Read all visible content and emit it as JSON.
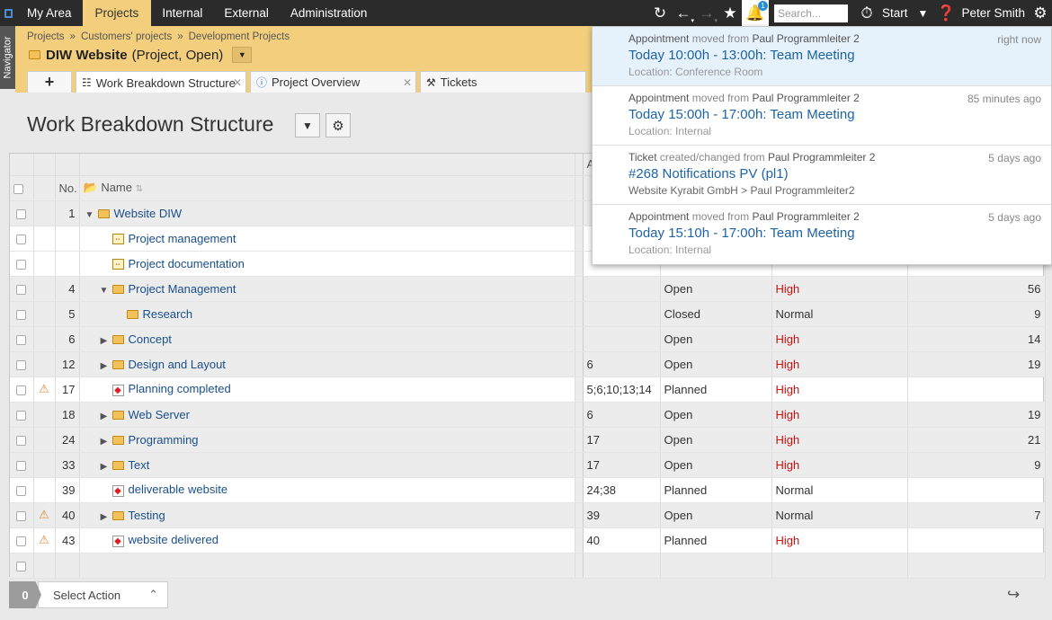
{
  "topnav": {
    "items": [
      "My Area",
      "Projects",
      "Internal",
      "External",
      "Administration"
    ],
    "active_index": 1
  },
  "toolbar": {
    "search_placeholder": "Search...",
    "start_label": "Start",
    "user_name": "Peter Smith",
    "notification_count": "1"
  },
  "navigator_label": "Navigator",
  "breadcrumb": [
    "Projects",
    "»",
    "Customers' projects",
    "»",
    "Development Projects"
  ],
  "project": {
    "name": "DIW Website",
    "status": "(Project, Open)"
  },
  "tabs": [
    {
      "label": "Work Breakdown Structure",
      "active": true
    },
    {
      "label": "Project Overview",
      "active": false
    },
    {
      "label": "Tickets",
      "active": false
    }
  ],
  "page_title": "Work Breakdown Structure",
  "grid": {
    "columns": {
      "no": "No.",
      "name": "Name",
      "a": "A"
    },
    "rows": [
      {
        "no": "1",
        "name": "Website DIW",
        "kind": "folder",
        "indent": 0,
        "expander": "open",
        "warn": false,
        "dep": "",
        "status": "",
        "priority": "",
        "num": ""
      },
      {
        "no": "",
        "name": "Project management",
        "kind": "task",
        "indent": 1,
        "expander": "",
        "warn": false,
        "dep": "",
        "status": "",
        "priority": "",
        "num": ""
      },
      {
        "no": "",
        "name": "Project documentation",
        "kind": "task",
        "indent": 1,
        "expander": "",
        "warn": false,
        "dep": "",
        "status": "",
        "priority": "",
        "num": ""
      },
      {
        "no": "4",
        "name": "Project Management",
        "kind": "folder",
        "indent": 1,
        "expander": "open",
        "warn": false,
        "dep": "",
        "status": "Open",
        "priority": "High",
        "num": "56"
      },
      {
        "no": "5",
        "name": "Research",
        "kind": "folder",
        "indent": 2,
        "expander": "",
        "warn": false,
        "dep": "",
        "status": "Closed",
        "priority": "Normal",
        "num": "9"
      },
      {
        "no": "6",
        "name": "Concept",
        "kind": "folder",
        "indent": 1,
        "expander": "closed",
        "warn": false,
        "dep": "",
        "status": "Open",
        "priority": "High",
        "num": "14"
      },
      {
        "no": "12",
        "name": "Design and Layout",
        "kind": "folder",
        "indent": 1,
        "expander": "closed",
        "warn": false,
        "dep": "6",
        "status": "Open",
        "priority": "High",
        "num": "19"
      },
      {
        "no": "17",
        "name": "Planning completed",
        "kind": "milestone",
        "indent": 1,
        "expander": "",
        "warn": true,
        "dep": "5;6;10;13;14",
        "status": "Planned",
        "priority": "High",
        "num": ""
      },
      {
        "no": "18",
        "name": "Web Server",
        "kind": "folder",
        "indent": 1,
        "expander": "closed",
        "warn": false,
        "dep": "6",
        "status": "Open",
        "priority": "High",
        "num": "19"
      },
      {
        "no": "24",
        "name": "Programming",
        "kind": "folder",
        "indent": 1,
        "expander": "closed",
        "warn": false,
        "dep": "17",
        "status": "Open",
        "priority": "High",
        "num": "21"
      },
      {
        "no": "33",
        "name": "Text",
        "kind": "folder",
        "indent": 1,
        "expander": "closed",
        "warn": false,
        "dep": "17",
        "status": "Open",
        "priority": "High",
        "num": "9"
      },
      {
        "no": "39",
        "name": "deliverable website",
        "kind": "milestone",
        "indent": 1,
        "expander": "",
        "warn": false,
        "dep": "24;38",
        "status": "Planned",
        "priority": "Normal",
        "num": ""
      },
      {
        "no": "40",
        "name": "Testing",
        "kind": "folder",
        "indent": 1,
        "expander": "closed",
        "warn": true,
        "dep": "39",
        "status": "Open",
        "priority": "Normal",
        "num": "7"
      },
      {
        "no": "43",
        "name": "website delivered",
        "kind": "milestone",
        "indent": 1,
        "expander": "",
        "warn": true,
        "dep": "40",
        "status": "Planned",
        "priority": "High",
        "num": ""
      }
    ]
  },
  "footer": {
    "selected_count": "0",
    "select_action": "Select Action"
  },
  "notifications": [
    {
      "type": "Appointment",
      "action": "moved from",
      "author": "Paul Programmleiter 2",
      "time": "right now",
      "title": "Today 10:00h - 13:00h: Team Meeting",
      "sub": "Location: Conference Room",
      "unread": true
    },
    {
      "type": "Appointment",
      "action": "moved from",
      "author": "Paul Programmleiter 2",
      "time": "85 minutes ago",
      "title": "Today 15:00h - 17:00h: Team Meeting",
      "sub": "Location: Internal",
      "unread": false
    },
    {
      "type": "Ticket",
      "action": "created/changed from",
      "author": "Paul Programmleiter 2",
      "time": "5 days ago",
      "title": "#268 Notifications PV (pl1)",
      "sub": "Website Kyrabit GmbH > Paul Programmleiter2",
      "unread": false
    },
    {
      "type": "Appointment",
      "action": "moved from",
      "author": "Paul Programmleiter 2",
      "time": "5 days ago",
      "title": "Today 15:10h - 17:00h: Team Meeting",
      "sub": "Location: Internal",
      "unread": false
    }
  ]
}
